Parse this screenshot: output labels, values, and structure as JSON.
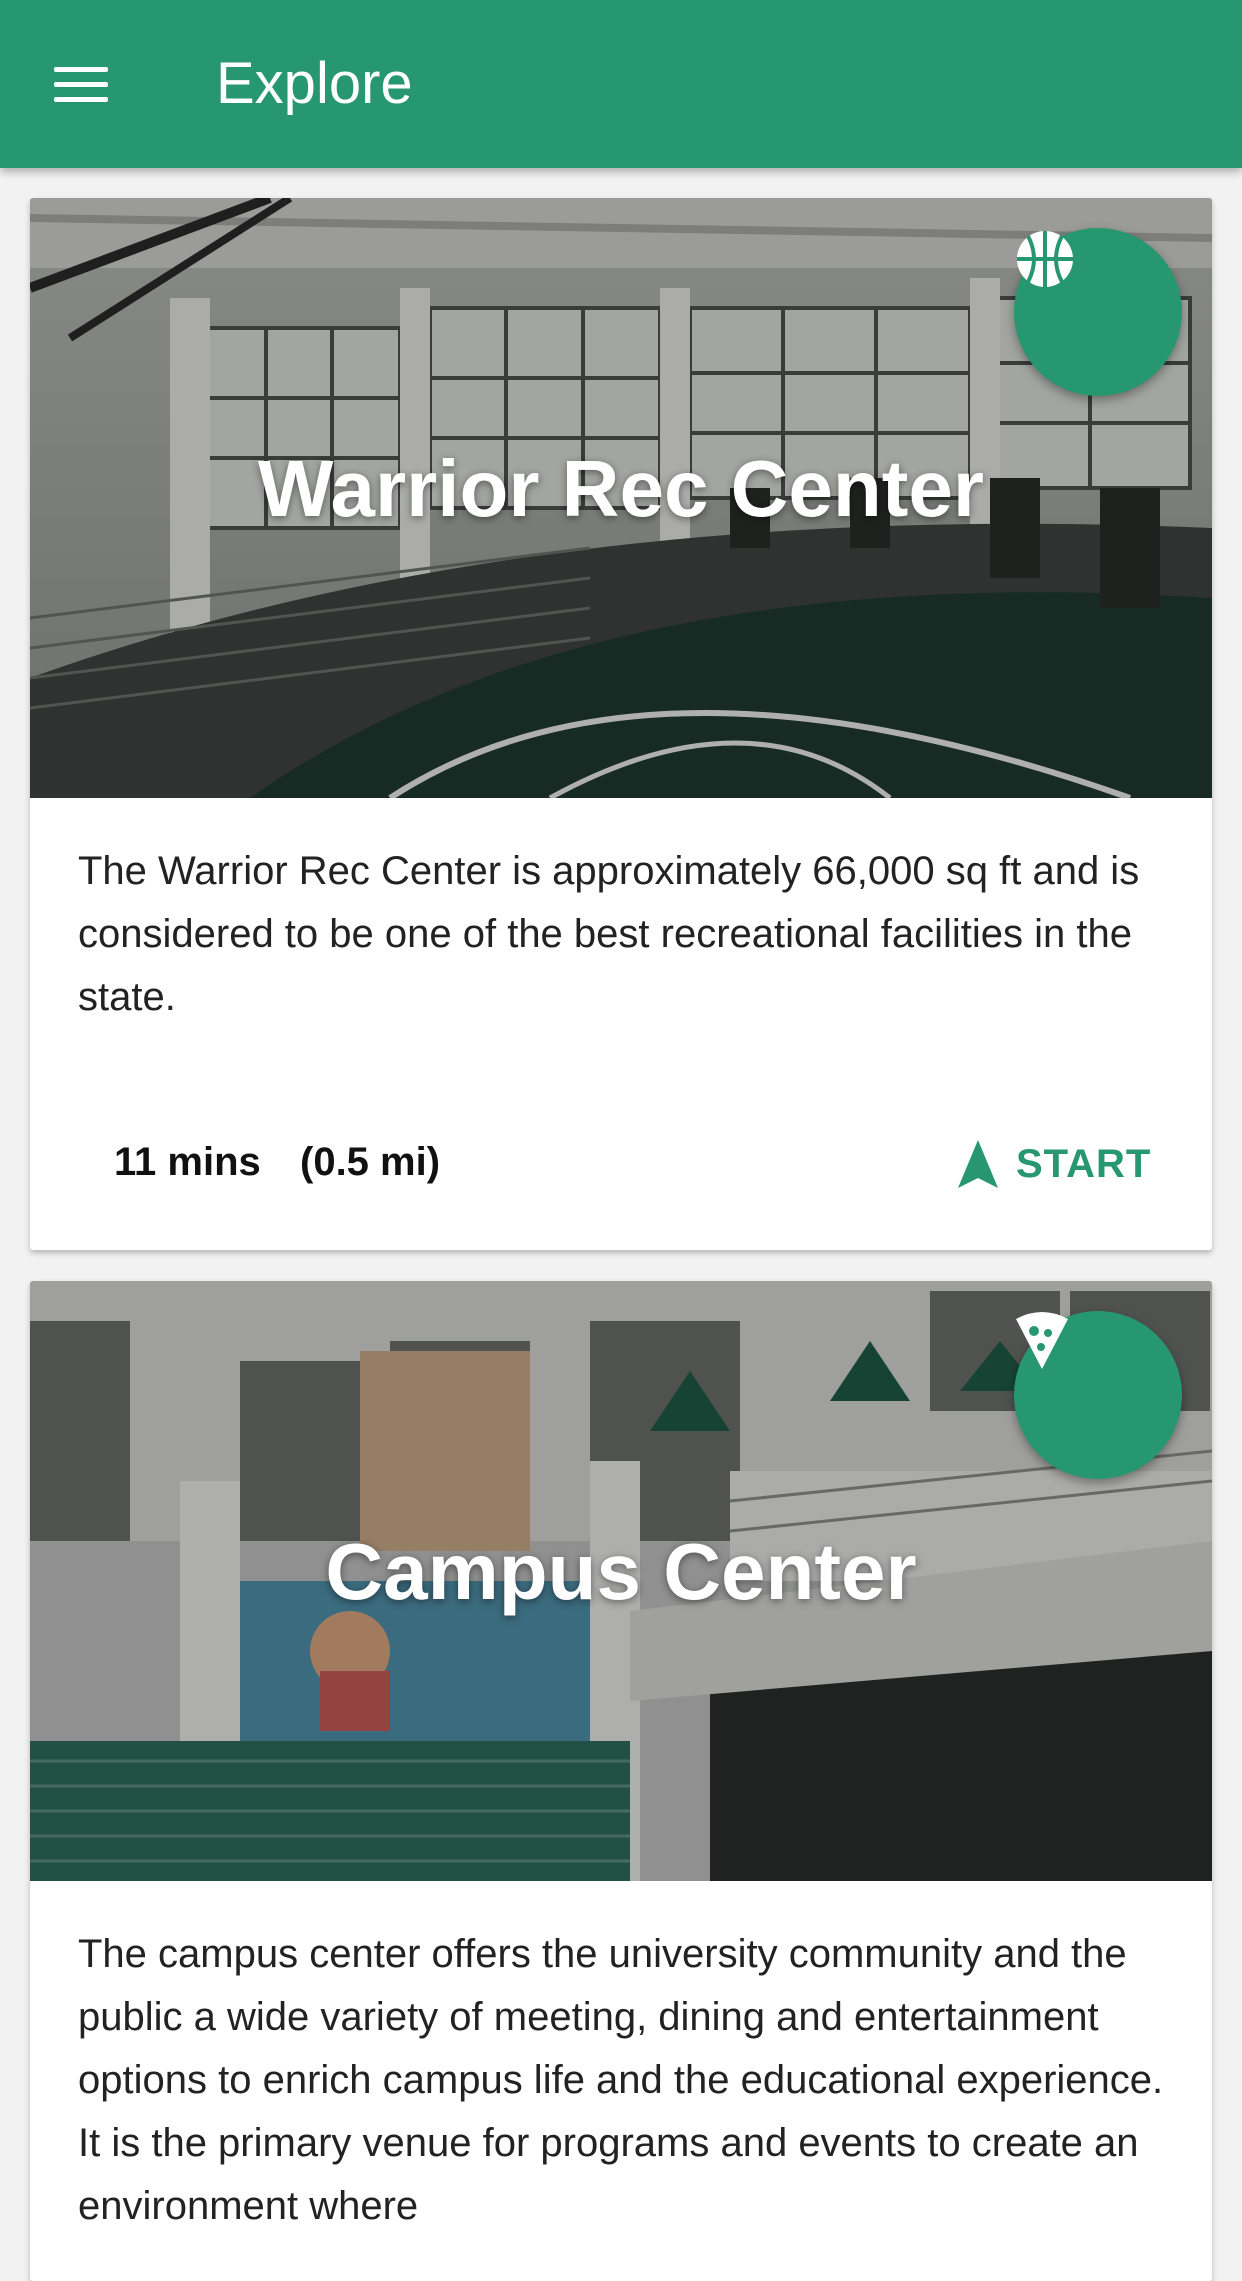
{
  "appbar": {
    "title": "Explore",
    "menu_icon": "menu-icon"
  },
  "colors": {
    "primary": "#279771",
    "card_bg": "#ffffff",
    "page_bg": "#f2f2f2"
  },
  "cards": [
    {
      "title": "Warrior Rec Center",
      "category_icon": "basketball-icon",
      "description": "The Warrior Rec Center is approximately 66,000 sq ft and is considered to be one of the best recreational facilities in the state.",
      "duration": "11 mins",
      "distance": "(0.5 mi)",
      "action_label": "START",
      "action_icon": "navigation-arrow-icon"
    },
    {
      "title": "Campus Center",
      "category_icon": "pizza-icon",
      "description": "The campus center offers the university community and the public a wide variety of meeting, dining and entertainment options to enrich campus life and the educational experience. It is the primary venue for programs and events to create an environment where"
    }
  ]
}
